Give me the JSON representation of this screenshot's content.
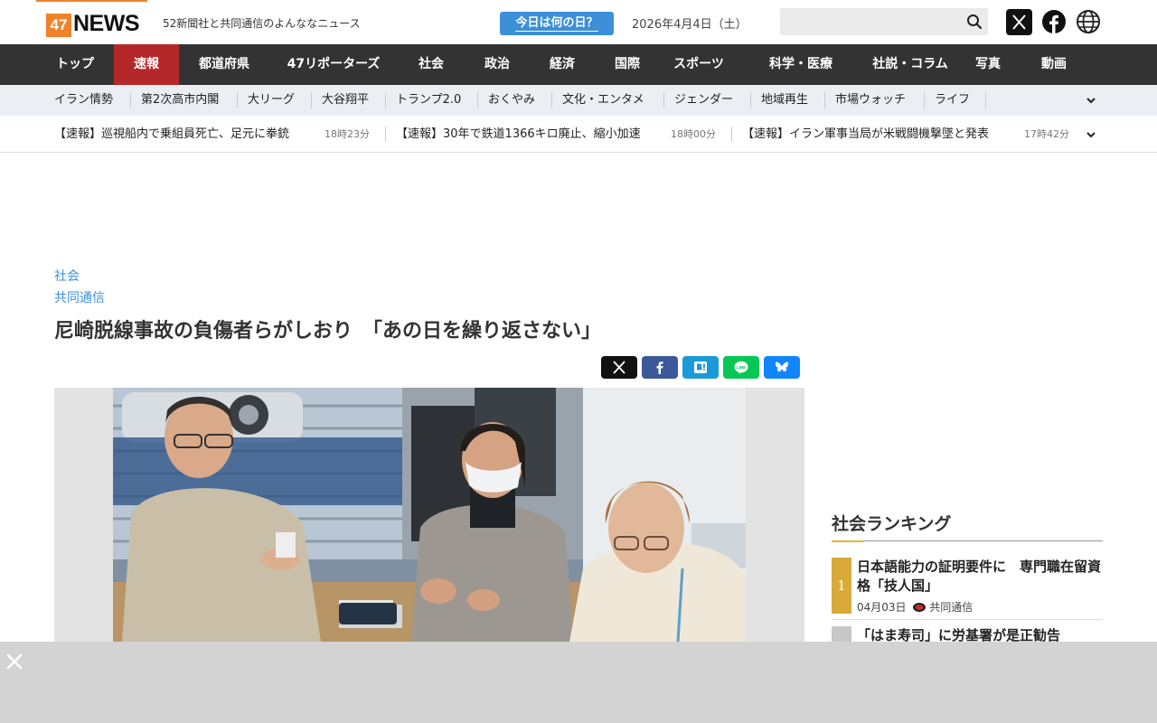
{
  "header": {
    "logo_num": "47",
    "logo_text": "NEWS",
    "tagline": "52新聞社と共同通信のよんななニュース",
    "today_button": "今日は何の日？",
    "date": "2026年4月4日（土）",
    "search_placeholder": ""
  },
  "main_nav": [
    "トップ",
    "速報",
    "都道府県",
    "47リポーターズ",
    "社会",
    "政治",
    "経済",
    "国際",
    "スポーツ",
    "科学・医療",
    "社説・コラム",
    "写真",
    "動画"
  ],
  "sub_nav": [
    "イラン情勢",
    "第2次高市内閣",
    "大リーグ",
    "大谷翔平",
    "トランプ2.0",
    "おくやみ",
    "文化・エンタメ",
    "ジェンダー",
    "地域再生",
    "市場ウォッチ",
    "ライフ"
  ],
  "ticker": [
    {
      "text": "【速報】巡視船内で乗組員死亡、足元に拳銃",
      "time": "18時23分"
    },
    {
      "text": "【速報】30年で鉄道1366キロ廃止、縮小加速",
      "time": "18時00分"
    },
    {
      "text": "【速報】イラン軍事当局が米戦闘機撃墜と発表",
      "time": "17時42分"
    }
  ],
  "article": {
    "category": "社会",
    "source": "共同通信",
    "title": "尼崎脱線事故の負傷者らがしおり　「あの日を繰り返さない」"
  },
  "ranking": {
    "title": "社会ランキング",
    "items": [
      {
        "rank": "1",
        "text": "日本語能力の証明要件に　専門職在留資格「技人国」",
        "date": "04月03日",
        "source": "共同通信"
      },
      {
        "rank": "",
        "text": "「はま寿司」に労基署が是正勧告"
      }
    ]
  },
  "colors": {
    "brand": "#f0822a",
    "nav_bg": "#333333",
    "nav_active": "#b5282a",
    "link": "#3c8fd8",
    "rank_gold": "#d9a93a"
  }
}
